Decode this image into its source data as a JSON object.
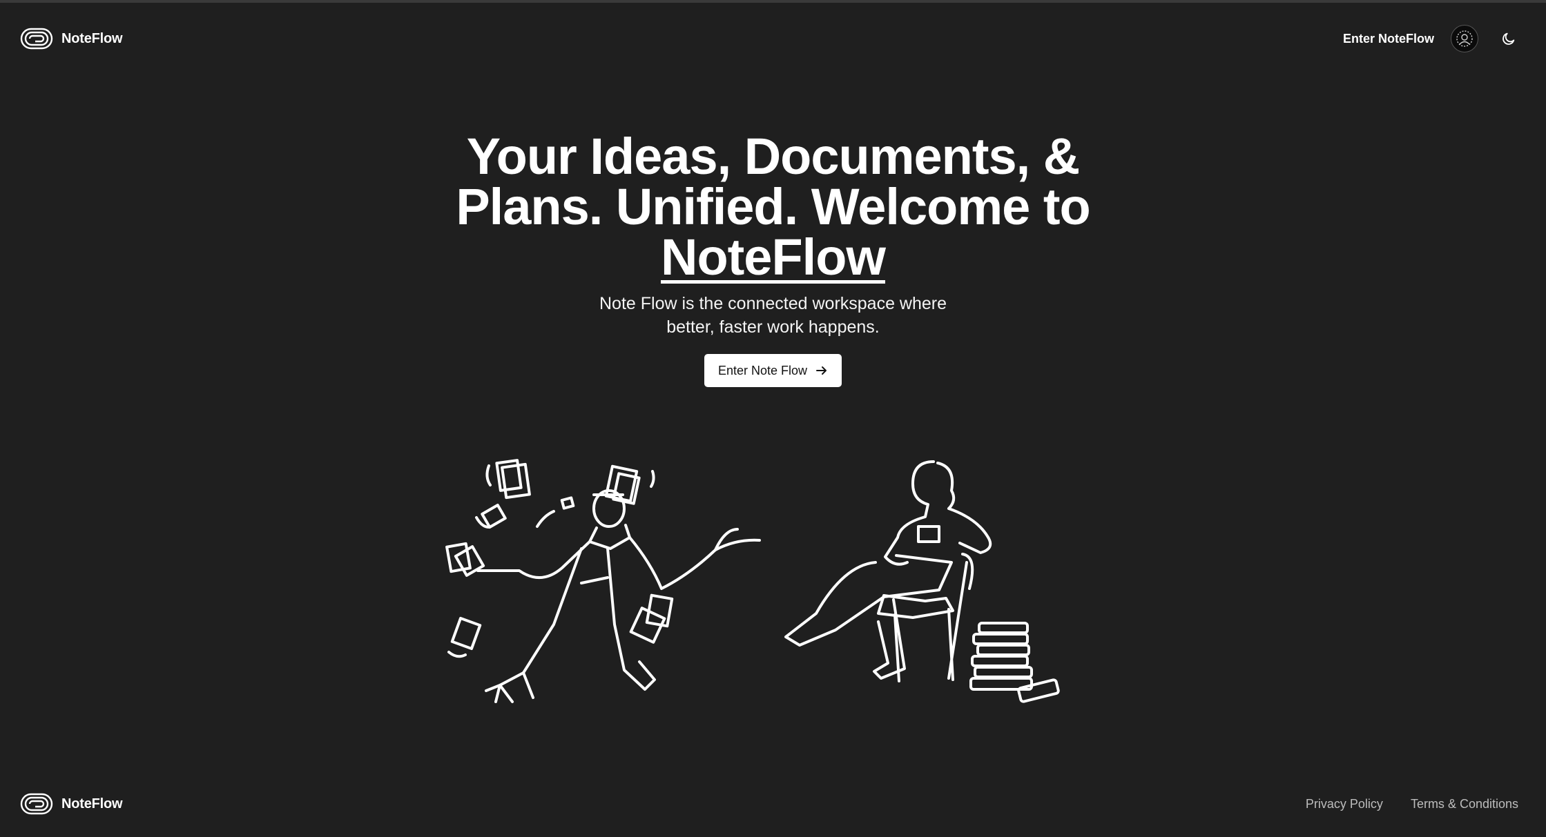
{
  "header": {
    "brand": "NoteFlow",
    "enter_link": "Enter NoteFlow",
    "theme_toggle_icon": "moon-icon",
    "avatar_icon": "avatar-icon"
  },
  "hero": {
    "title_main": "Your Ideas, Documents, & Plans. Unified. Welcome to ",
    "title_emph": "NoteFlow",
    "subtitle": "Note Flow is the connected workspace where better, faster work happens.",
    "cta_label": "Enter Note Flow",
    "cta_icon": "arrow-right-icon"
  },
  "footer": {
    "brand": "NoteFlow",
    "links": [
      "Privacy Policy",
      "Terms & Conditions"
    ]
  },
  "colors": {
    "background": "#1f1f1f",
    "text": "#ffffff",
    "muted": "#bdbdbd",
    "button_bg": "#ffffff"
  }
}
